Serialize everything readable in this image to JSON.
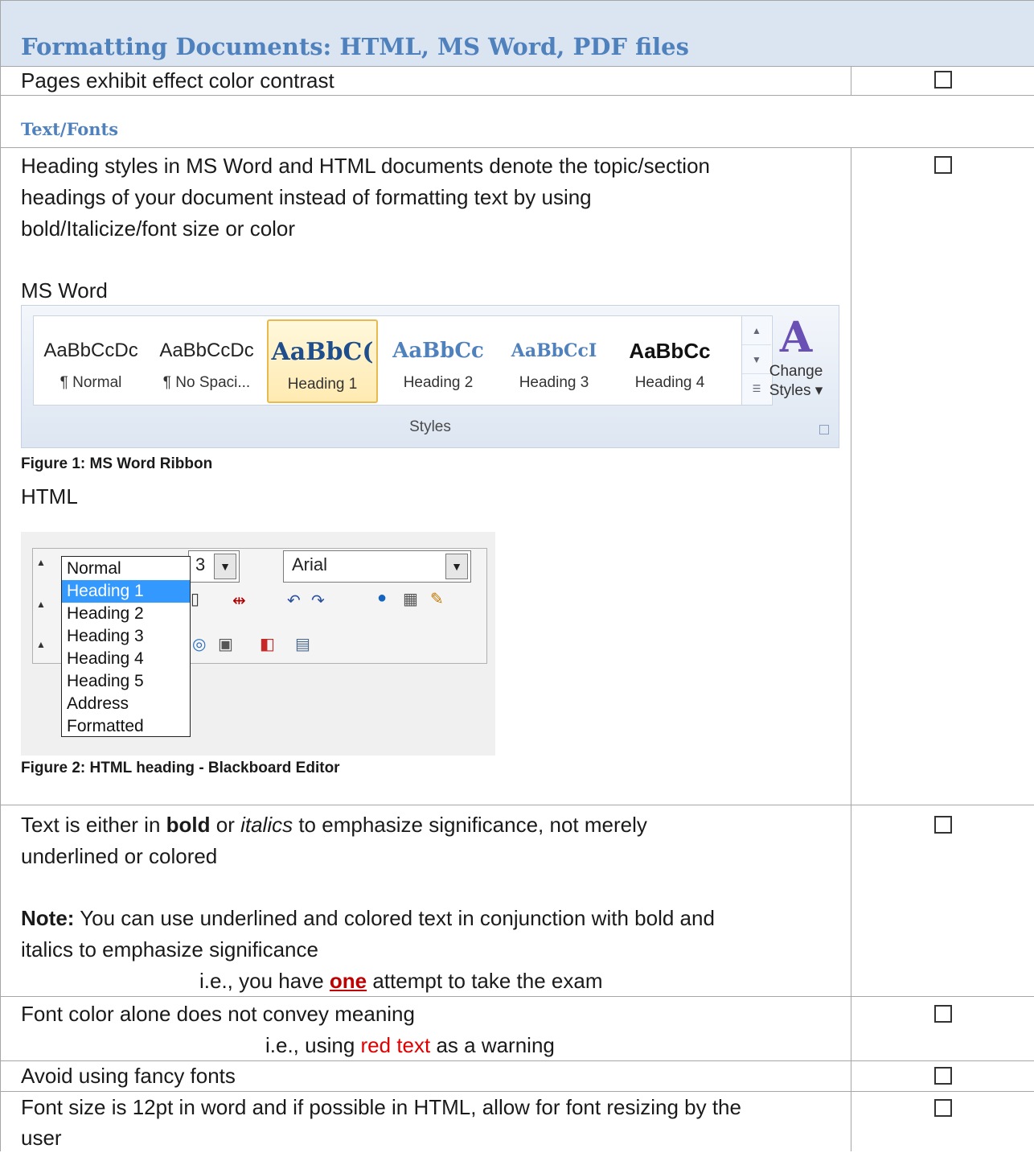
{
  "section": {
    "title": "Formatting Documents: HTML, MS Word, PDF files",
    "subsection": "Text/Fonts"
  },
  "checkbox_glyph": "☐",
  "rows": {
    "contrast": "Pages exhibit effect color contrast",
    "headings_1": "Heading styles in MS Word and HTML documents denote the topic/section",
    "headings_2": "headings of your document instead of formatting text by using",
    "headings_3": "bold/Italicize/font size or color",
    "ms_word_label": "MS Word",
    "figure1_caption": "Figure 1: MS  Word Ribbon",
    "html_label": "HTML",
    "figure2_caption": "Figure 2: HTML heading - Blackboard Editor",
    "emph_1a": "Text is either in ",
    "emph_bold": "bold",
    "emph_or": " or ",
    "emph_italics": "italics",
    "emph_1b": " to emphasize significance, not merely",
    "emph_2": "underlined or colored",
    "note_label": "Note:",
    "note_1": " You can use underlined and colored text  in conjunction with bold and",
    "note_2": "italics to emphasize significance",
    "example1_a": "i.e., you have ",
    "example1_one": "one",
    "example1_b": " attempt to take the exam",
    "color_meaning": "Font color alone does not convey meaning",
    "example2_a": "i.e., using ",
    "example2_red": "red text",
    "example2_b": " as a warning",
    "fancy_fonts": "Avoid using fancy fonts",
    "font_size_1": "Font size is 12pt in word and if possible in HTML, allow for font resizing by the",
    "font_size_2": "user"
  },
  "word_ribbon": {
    "styles": [
      {
        "sample": "AaBbCcDc",
        "name": "¶ Normal"
      },
      {
        "sample": "AaBbCcDc",
        "name": "¶ No Spaci..."
      },
      {
        "sample": "AaBbC(",
        "name": "Heading 1"
      },
      {
        "sample": "AaBbCc",
        "name": "Heading 2"
      },
      {
        "sample": "AaBbCcI",
        "name": "Heading 3"
      },
      {
        "sample": "AaBbCc",
        "name": "Heading 4"
      }
    ],
    "selected_index": 2,
    "change_styles_1": "Change",
    "change_styles_2": "Styles ▾",
    "group_label": "Styles",
    "change_icon": "A"
  },
  "html_editor": {
    "size_value": "3",
    "font_value": "Arial",
    "format_options": [
      "Normal",
      "Heading 1",
      "Heading 2",
      "Heading 3",
      "Heading 4",
      "Heading 5",
      "Address",
      "Formatted"
    ],
    "selected_index": 1
  },
  "colors": {
    "heading": "#4f81bd",
    "band": "#dbe5f1",
    "red": "#e00000",
    "selection": "#3399ff"
  }
}
